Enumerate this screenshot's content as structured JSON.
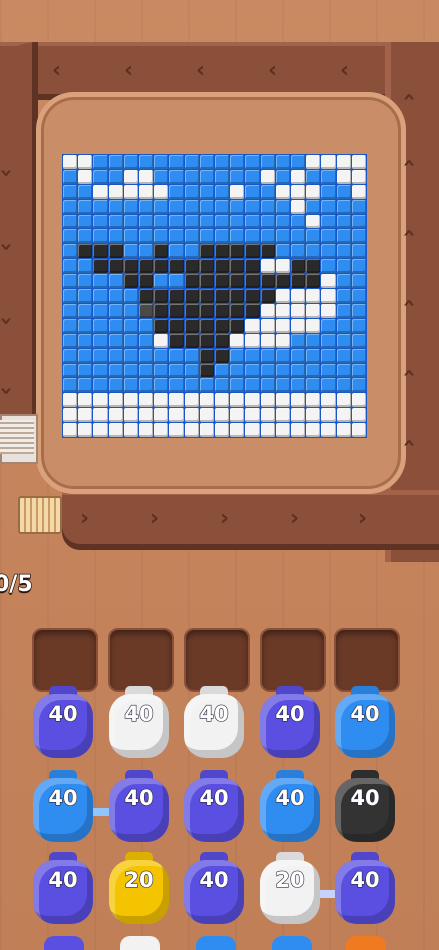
{
  "level": {
    "progress": "0/5"
  },
  "board": {
    "palette": {
      "W": "#f4f4f4",
      "L": "#2f8df2",
      "D": "#1f6fe0",
      "B": "#2a2a2a",
      "G": "#4a4a4a"
    },
    "rows": [
      "WWLLLLLLLLLLLLLLWWWW",
      "LWLLWWLLLLLLLWLWLLWW",
      "LLWWWWWLLLLWLLWWWLLW",
      "LLLLLLLLLLLLLLLWLLLL",
      "LLLLLLLLLLLLLLLLWLLL",
      "LLLLLLLLLLLLLLLLLLLL",
      "LBBBLLBLLBBBBBLLLLLL",
      "LLBBBBBBBBBBBWWBBLLL",
      "LLLLBBLLBBBBBBBBBWLL",
      "LLLLLBBBBBBBBBWWWWLL",
      "LLLLLGBBBBBBBWWWWWLL",
      "LLLLLLBBBBBBWWWWWLLL",
      "LLLLLLWBBBBWWWWLLLLL",
      "LLLLLLLLLBBLLLLLLLLL",
      "LLLLLLLLLBLLLLLLLLLL",
      "LLLLLLLLLLLLLLLLLLLL",
      "WWWWWWWWWWWWWWWWWWWW",
      "WWWWWWWWWWWWWWWWWWWW",
      "WWWWWWWWWWWWWWWWWWWW"
    ]
  },
  "jars": [
    {
      "label": "40",
      "color": "#5a4fe0",
      "col": 0,
      "row": 0
    },
    {
      "label": "40",
      "color": "#f2f2f2",
      "col": 1,
      "row": 0
    },
    {
      "label": "40",
      "color": "#f2f2f2",
      "col": 2,
      "row": 0
    },
    {
      "label": "40",
      "color": "#5a4fe0",
      "col": 3,
      "row": 0
    },
    {
      "label": "40",
      "color": "#2f8df2",
      "col": 4,
      "row": 0
    },
    {
      "label": "40",
      "color": "#2f8df2",
      "col": 0,
      "row": 1
    },
    {
      "label": "40",
      "color": "#5a4fe0",
      "col": 1,
      "row": 1
    },
    {
      "label": "40",
      "color": "#5a4fe0",
      "col": 2,
      "row": 1
    },
    {
      "label": "40",
      "color": "#2f8df2",
      "col": 3,
      "row": 1
    },
    {
      "label": "40",
      "color": "#333333",
      "col": 4,
      "row": 1
    },
    {
      "label": "40",
      "color": "#5a4fe0",
      "col": 0,
      "row": 2
    },
    {
      "label": "20",
      "color": "#f5c400",
      "col": 1,
      "row": 2
    },
    {
      "label": "40",
      "color": "#5a4fe0",
      "col": 2,
      "row": 2
    },
    {
      "label": "20",
      "color": "#f2f2f2",
      "col": 3,
      "row": 2
    },
    {
      "label": "40",
      "color": "#5a4fe0",
      "col": 4,
      "row": 2
    }
  ],
  "links": [
    {
      "color": "#8ec7ff",
      "from": {
        "col": 0,
        "row": 1
      },
      "to": {
        "col": 1,
        "row": 1
      }
    },
    {
      "color": "#c7d2ff",
      "from": {
        "col": 3,
        "row": 2
      },
      "to": {
        "col": 4,
        "row": 2
      }
    }
  ]
}
